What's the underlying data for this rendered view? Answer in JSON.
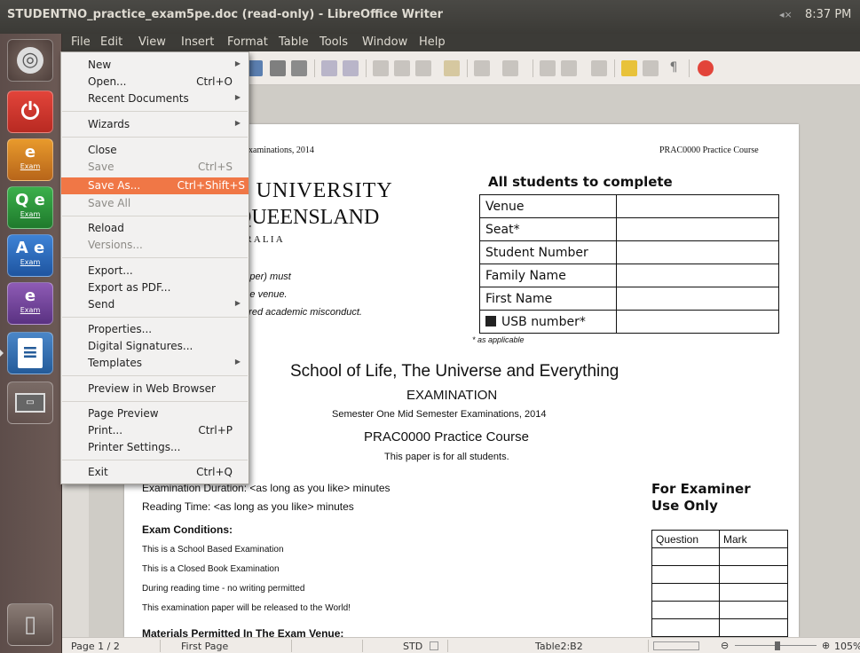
{
  "window": {
    "title": "STUDENTNO_practice_exam5pe.doc (read-only) - LibreOffice Writer",
    "volume_indicator": "◂×",
    "clock": "8:37 PM"
  },
  "menubar": [
    "File",
    "Edit",
    "View",
    "Insert",
    "Format",
    "Table",
    "Tools",
    "Window",
    "Help"
  ],
  "file_menu": {
    "items": [
      {
        "label": "New",
        "shortcut": "",
        "submenu": true,
        "disabled": false
      },
      {
        "label": "Open...",
        "shortcut": "Ctrl+O",
        "submenu": false,
        "disabled": false
      },
      {
        "label": "Recent Documents",
        "shortcut": "",
        "submenu": true,
        "disabled": false
      },
      {
        "label": "Wizards",
        "shortcut": "",
        "submenu": true,
        "disabled": false
      },
      {
        "label": "Close",
        "shortcut": "",
        "submenu": false,
        "disabled": false
      },
      {
        "label": "Save",
        "shortcut": "Ctrl+S",
        "submenu": false,
        "disabled": true
      },
      {
        "label": "Save As...",
        "shortcut": "Ctrl+Shift+S",
        "submenu": false,
        "disabled": false,
        "highlighted": true
      },
      {
        "label": "Save All",
        "shortcut": "",
        "submenu": false,
        "disabled": true
      },
      {
        "label": "Reload",
        "shortcut": "",
        "submenu": false,
        "disabled": false
      },
      {
        "label": "Versions...",
        "shortcut": "",
        "submenu": false,
        "disabled": true
      },
      {
        "label": "Export...",
        "shortcut": "",
        "submenu": false,
        "disabled": false
      },
      {
        "label": "Export as PDF...",
        "shortcut": "",
        "submenu": false,
        "disabled": false
      },
      {
        "label": "Send",
        "shortcut": "",
        "submenu": true,
        "disabled": false
      },
      {
        "label": "Properties...",
        "shortcut": "",
        "submenu": false,
        "disabled": false
      },
      {
        "label": "Digital Signatures...",
        "shortcut": "",
        "submenu": false,
        "disabled": false
      },
      {
        "label": "Templates",
        "shortcut": "",
        "submenu": true,
        "disabled": false
      },
      {
        "label": "Preview in Web Browser",
        "shortcut": "",
        "submenu": false,
        "disabled": false
      },
      {
        "label": "Page Preview",
        "shortcut": "",
        "submenu": false,
        "disabled": false
      },
      {
        "label": "Print...",
        "shortcut": "Ctrl+P",
        "submenu": false,
        "disabled": false
      },
      {
        "label": "Printer Settings...",
        "shortcut": "",
        "submenu": false,
        "disabled": false
      },
      {
        "label": "Exit",
        "shortcut": "Ctrl+Q",
        "submenu": false,
        "disabled": false
      }
    ]
  },
  "launcher": [
    {
      "name": "dash",
      "label": "◎"
    },
    {
      "name": "shutdown",
      "label": "⏻"
    },
    {
      "name": "exam-1",
      "label": "e",
      "badge": "Exam"
    },
    {
      "name": "exam-q",
      "label": "Q e",
      "badge": "Exam"
    },
    {
      "name": "exam-a",
      "label": "A e",
      "badge": "Exam"
    },
    {
      "name": "exam-bb",
      "label": "e",
      "badge": "Exam"
    },
    {
      "name": "writer",
      "label": "≡"
    },
    {
      "name": "workspace",
      "label": "▭"
    },
    {
      "name": "trash",
      "label": "▯"
    }
  ],
  "document": {
    "header_left": "ster Examinations, 2014",
    "header_right": "PRAC0000 Practice Course",
    "uni_line1": "E UNIVERSITY",
    "uni_line2": "QUEENSLAND",
    "uni_line3": "T R A L I A",
    "note1": "3/paper) must",
    "note2": "m the venue.",
    "note3": "sidered academic misconduct.",
    "students_heading": "All students to complete",
    "student_fields": [
      "Venue",
      "Seat*",
      "Student Number",
      "Family Name",
      "First Name",
      "USB number*"
    ],
    "as_applicable": "* as applicable",
    "school_title": "School of Life, The Universe and Everything",
    "exam_word": "EXAMINATION",
    "semester_line": "Semester One Mid Semester Examinations, 2014",
    "course_line": "PRAC0000 Practice Course",
    "paper_for": "This paper is for all students.",
    "duration": "Examination Duration: <as long as you like> minutes",
    "reading": "Reading Time: <as long as you like> minutes",
    "conditions_heading": "Exam Conditions:",
    "conditions": [
      "This is a School Based Examination",
      "This is a Closed Book Examination",
      "During reading time - no writing permitted",
      "This examination paper will be released to the World!"
    ],
    "materials_heading": "Materials Permitted In The Exam Venue:",
    "examiner_heading_1": "For Examiner",
    "examiner_heading_2": "Use Only",
    "examiner_cols": [
      "Question",
      "Mark"
    ]
  },
  "statusbar": {
    "page": "Page 1 / 2",
    "style": "First Page",
    "mode": "STD",
    "cell": "Table2:B2",
    "zoom": "105%"
  }
}
